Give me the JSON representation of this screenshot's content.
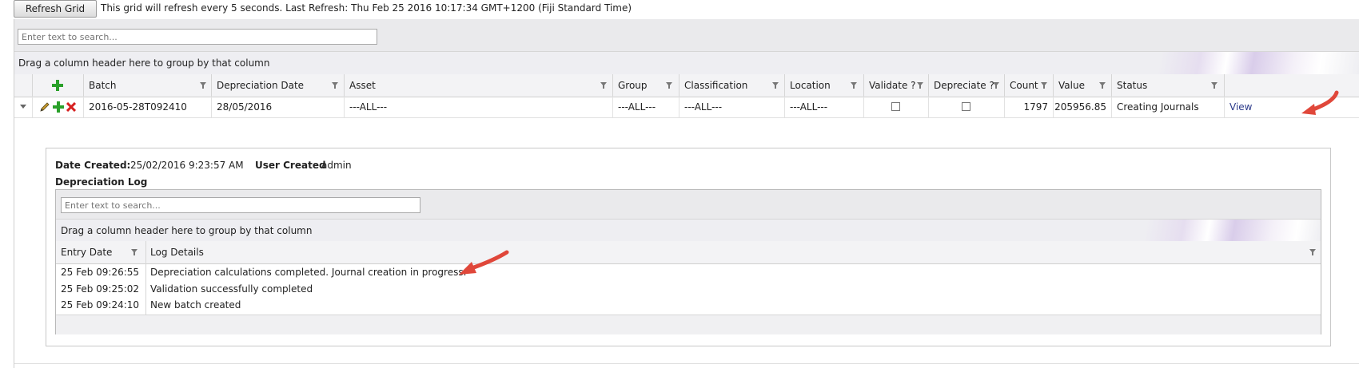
{
  "toolbar": {
    "refresh_label": "Refresh Grid",
    "refresh_message": "This grid will refresh every 5 seconds. Last Refresh: Thu Feb 25 2016 10:17:34 GMT+1200 (Fiji Standard Time)"
  },
  "grid": {
    "search_placeholder": "Enter text to search...",
    "group_hint": "Drag a column header here to group by that column",
    "columns": [
      "Batch",
      "Depreciation Date",
      "Asset",
      "Group",
      "Classification",
      "Location",
      "Validate ?",
      "Depreciate ?",
      "Count",
      "Value",
      "Status"
    ],
    "row": {
      "batch": "2016-05-28T092410",
      "depreciation_date": "28/05/2016",
      "asset": "---ALL---",
      "group": "---ALL---",
      "classification": "---ALL---",
      "location": "---ALL---",
      "validate": false,
      "depreciate": false,
      "count": "1797",
      "value": "205956.85",
      "status": "Creating Journals",
      "view_label": "View"
    }
  },
  "detail": {
    "date_created_label": "Date Created:",
    "date_created_value": "25/02/2016 9:23:57 AM",
    "user_created_label": "User Created",
    "user_created_value": "admin",
    "log_title": "Depreciation Log",
    "search_placeholder": "Enter text to search...",
    "group_hint": "Drag a column header here to group by that column",
    "columns": [
      "Entry Date",
      "Log Details"
    ],
    "rows": [
      {
        "date": "25 Feb 09:26:55",
        "details": "Depreciation calculations completed. Journal creation in progress."
      },
      {
        "date": "25 Feb 09:25:02",
        "details": "Validation successfully completed"
      },
      {
        "date": "25 Feb 09:24:10",
        "details": "New batch created"
      }
    ]
  },
  "colors": {
    "annotation_arrow": "#e0473a",
    "add_icon": "#2aa02a",
    "delete_icon": "#d62020"
  }
}
